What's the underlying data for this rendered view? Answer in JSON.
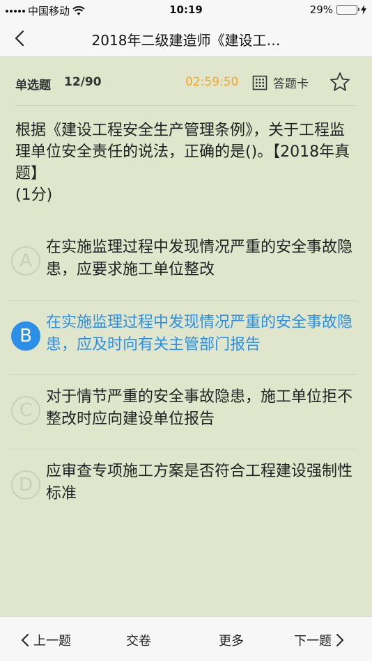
{
  "status": {
    "carrier": "中国移动",
    "time": "10:19",
    "battery": "29%",
    "battery_level": 0.29
  },
  "nav": {
    "title": "2018年二级建造师《建设工…"
  },
  "question_header": {
    "type": "单选题",
    "progress": "12/90",
    "timer": "02:59:50",
    "answer_card": "答题卡"
  },
  "question": {
    "text": "根据《建设工程安全生产管理条例》，关于工程监理单位安全责任的说法，正确的是()。【2018年真题】",
    "score": "(1分)"
  },
  "options": [
    {
      "letter": "A",
      "text": "在实施监理过程中发现情况严重的安全事故隐患，应要求施工单位整改",
      "selected": false
    },
    {
      "letter": "B",
      "text": "在实施监理过程中发现情况严重的安全事故隐患，应及时向有关主管部门报告",
      "selected": true
    },
    {
      "letter": "C",
      "text": "对于情节严重的安全事故隐患，施工单位拒不整改时应向建设单位报告",
      "selected": false
    },
    {
      "letter": "D",
      "text": "应审查专项施工方案是否符合工程建设强制性标准",
      "selected": false
    }
  ],
  "bottom": {
    "prev": "上一题",
    "submit": "交卷",
    "more": "更多",
    "next": "下一题"
  },
  "colors": {
    "background": "#dfe6cc",
    "timer": "#f5a623",
    "accent": "#2b8fe8",
    "battery": "#4cd964"
  }
}
